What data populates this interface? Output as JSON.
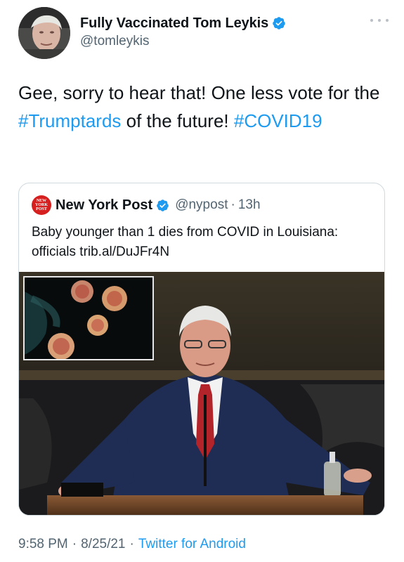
{
  "author": {
    "display_name": "Fully Vaccinated Tom Leykis",
    "handle": "@tomleykis",
    "verified": true
  },
  "tweet": {
    "text_part1": "Gee, sorry to hear that! One less vote for the ",
    "hashtag1": "#Trumptards",
    "text_part2": " of the future! ",
    "hashtag2": "#COVID19"
  },
  "quoted_tweet": {
    "logo_text": "NEW YORK POST",
    "display_name": "New York Post",
    "handle": "@nypost",
    "separator": "·",
    "time": "13h",
    "text": "Baby younger than 1 dies from COVID in Louisiana: officials trib.al/DuJFr4N"
  },
  "footer": {
    "time": "9:58 PM",
    "sep1": "·",
    "date": "8/25/21",
    "sep2": "·",
    "source": "Twitter for Android"
  },
  "colors": {
    "accent": "#1d9bf0",
    "secondary_text": "#536471",
    "border": "#cfd9de",
    "nypost_red": "#d6201f"
  },
  "icons": {
    "verified": "verified-badge-icon",
    "more": "more-dots-icon"
  }
}
